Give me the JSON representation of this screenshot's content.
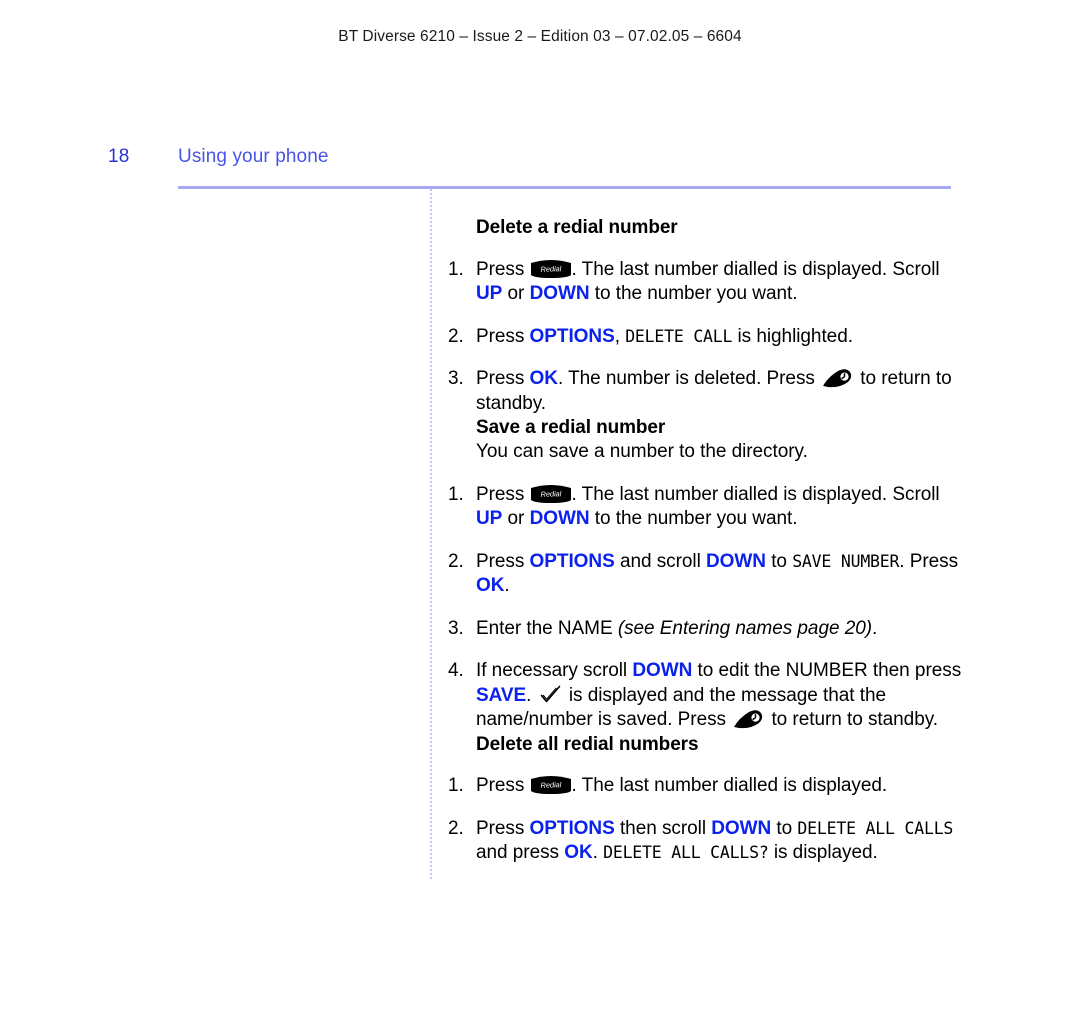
{
  "header": {
    "running_head": "BT Diverse 6210 – Issue 2 – Edition 03 – 07.02.05 – 6604"
  },
  "page": {
    "number": "18",
    "section_title": "Using your phone"
  },
  "colors": {
    "key_blue": "#0b22ee",
    "title_blue": "#4a53e8",
    "page_number_blue": "#2b33d6",
    "rule_blue": "#a8a9f5",
    "dotted_rule_blue": "#c3c6f7"
  },
  "icons": {
    "redial": "redial-key-icon",
    "hangup": "hangup-key-icon",
    "tick": "tick-icon"
  },
  "sections": [
    {
      "heading": "Delete a redial number",
      "intro": null,
      "steps": [
        {
          "number": "1.",
          "parts": [
            {
              "t": "text",
              "v": "Press "
            },
            {
              "t": "icon",
              "v": "redial"
            },
            {
              "t": "text",
              "v": ". The last number dialled is displayed. Scroll "
            },
            {
              "t": "key",
              "v": "UP"
            },
            {
              "t": "text",
              "v": " or "
            },
            {
              "t": "key",
              "v": "DOWN"
            },
            {
              "t": "text",
              "v": " to the number you want."
            }
          ]
        },
        {
          "number": "2.",
          "parts": [
            {
              "t": "text",
              "v": "Press "
            },
            {
              "t": "key",
              "v": "OPTIONS"
            },
            {
              "t": "text",
              "v": ", "
            },
            {
              "t": "lcd",
              "v": "DELETE CALL"
            },
            {
              "t": "text",
              "v": " is highlighted."
            }
          ]
        },
        {
          "number": "3.",
          "parts": [
            {
              "t": "text",
              "v": "Press "
            },
            {
              "t": "key",
              "v": "OK"
            },
            {
              "t": "text",
              "v": ". The number is deleted. Press "
            },
            {
              "t": "icon",
              "v": "hangup"
            },
            {
              "t": "text",
              "v": " to return to standby."
            }
          ]
        }
      ]
    },
    {
      "heading": "Save a redial number",
      "intro": "You can save a number to the directory.",
      "steps": [
        {
          "number": "1.",
          "parts": [
            {
              "t": "text",
              "v": "Press "
            },
            {
              "t": "icon",
              "v": "redial"
            },
            {
              "t": "text",
              "v": ". The last number dialled is displayed. Scroll "
            },
            {
              "t": "key",
              "v": "UP"
            },
            {
              "t": "text",
              "v": " or "
            },
            {
              "t": "key",
              "v": "DOWN"
            },
            {
              "t": "text",
              "v": " to the number you want."
            }
          ]
        },
        {
          "number": "2.",
          "parts": [
            {
              "t": "text",
              "v": "Press "
            },
            {
              "t": "key",
              "v": "OPTIONS"
            },
            {
              "t": "text",
              "v": " and scroll "
            },
            {
              "t": "key",
              "v": "DOWN"
            },
            {
              "t": "text",
              "v": " to "
            },
            {
              "t": "lcd",
              "v": "SAVE NUMBER"
            },
            {
              "t": "text",
              "v": ". Press "
            },
            {
              "t": "key",
              "v": "OK"
            },
            {
              "t": "text",
              "v": "."
            }
          ]
        },
        {
          "number": "3.",
          "parts": [
            {
              "t": "text",
              "v": "Enter the NAME "
            },
            {
              "t": "ital",
              "v": "(see Entering names page 20)"
            },
            {
              "t": "text",
              "v": "."
            }
          ]
        },
        {
          "number": "4.",
          "parts": [
            {
              "t": "text",
              "v": "If necessary scroll "
            },
            {
              "t": "key",
              "v": "DOWN"
            },
            {
              "t": "text",
              "v": " to edit the NUMBER then press "
            },
            {
              "t": "key",
              "v": "SAVE"
            },
            {
              "t": "text",
              "v": ". "
            },
            {
              "t": "icon",
              "v": "tick"
            },
            {
              "t": "text",
              "v": " is displayed and the message that the name/number is saved. Press "
            },
            {
              "t": "icon",
              "v": "hangup"
            },
            {
              "t": "text",
              "v": " to return to standby."
            }
          ]
        }
      ]
    },
    {
      "heading": "Delete all redial numbers",
      "intro": null,
      "steps": [
        {
          "number": "1.",
          "parts": [
            {
              "t": "text",
              "v": "Press "
            },
            {
              "t": "icon",
              "v": "redial"
            },
            {
              "t": "text",
              "v": ". The last number dialled is displayed."
            }
          ]
        },
        {
          "number": "2.",
          "parts": [
            {
              "t": "text",
              "v": "Press "
            },
            {
              "t": "key",
              "v": "OPTIONS"
            },
            {
              "t": "text",
              "v": " then scroll "
            },
            {
              "t": "key",
              "v": "DOWN"
            },
            {
              "t": "text",
              "v": " to "
            },
            {
              "t": "lcd",
              "v": "DELETE ALL CALLS"
            },
            {
              "t": "text",
              "v": " and press "
            },
            {
              "t": "key",
              "v": "OK"
            },
            {
              "t": "text",
              "v": ". "
            },
            {
              "t": "lcd",
              "v": "DELETE ALL CALLS?"
            },
            {
              "t": "text",
              "v": " is displayed."
            }
          ]
        }
      ]
    }
  ]
}
